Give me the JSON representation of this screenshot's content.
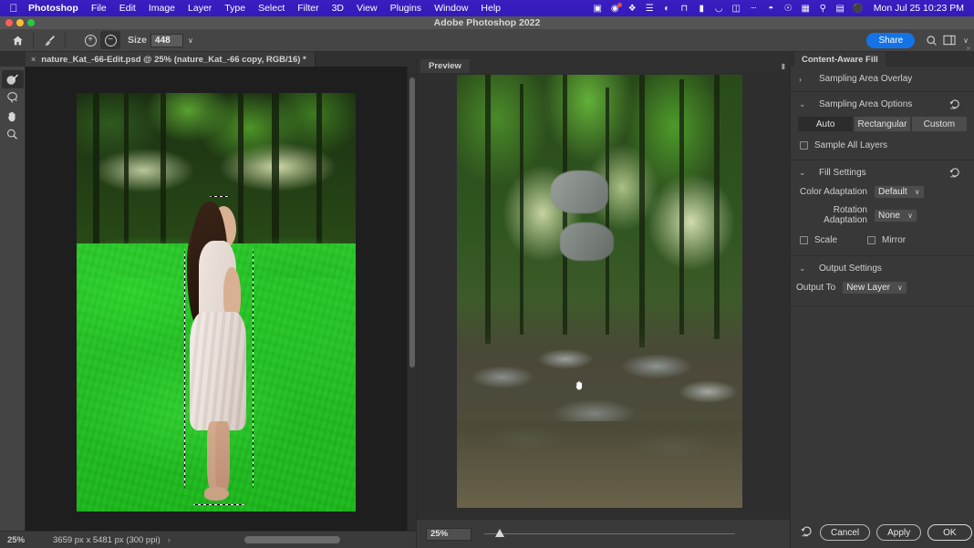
{
  "macos": {
    "apple_icon": "apple-icon",
    "menus": [
      "Photoshop",
      "File",
      "Edit",
      "Image",
      "Layer",
      "Type",
      "Select",
      "Filter",
      "3D",
      "View",
      "Plugins",
      "Window",
      "Help"
    ],
    "status_icons": [
      "screen-record-icon",
      "camera-icon",
      "dropbox-icon",
      "grid-icon",
      "time-machine-icon",
      "notion-icon",
      "bookmark-icon",
      "arc-icon",
      "columns-icon",
      "bluetooth-icon",
      "wifi-icon",
      "user-icon",
      "display-icon",
      "search-icon",
      "control-center-icon",
      "siri-icon"
    ],
    "clock": "Mon Jul 25  10:23 PM"
  },
  "titlebar": {
    "title": "Adobe Photoshop 2022",
    "close": "close-button",
    "minimize": "minimize-button",
    "maximize": "maximize-button"
  },
  "options_bar": {
    "home_icon": "home-icon",
    "tool_icon": "brush-tool-icon",
    "add_icon": "+",
    "subtract_icon": "−",
    "size_label": "Size",
    "size_value": "448",
    "size_caret": "∨",
    "share_label": "Share",
    "search_icon": "search-icon",
    "workspace_icon": "workspace-icon",
    "workspace_caret": "∨"
  },
  "document_tab": {
    "close_icon": "×",
    "title": "nature_Kat_-66-Edit.psd @ 25% (nature_Kat_-66 copy, RGB/16) *"
  },
  "toolbar": {
    "tools": [
      {
        "name": "sampling-brush-tool",
        "glyph": "὘",
        "active": true
      },
      {
        "name": "lasso-tool",
        "glyph": "␢",
        "active": false
      },
      {
        "name": "hand-tool",
        "glyph": "✋",
        "active": false
      },
      {
        "name": "zoom-tool",
        "glyph": "⚲",
        "active": false
      }
    ]
  },
  "canvas": {
    "alt": "Photo of a woman in a white dress standing in a green forest with a marching-ants selection around her and a green sampling-area overlay"
  },
  "statusbar": {
    "zoom": "25%",
    "dimensions": "3659 px x 5481 px (300 ppi)",
    "arrow": "›"
  },
  "preview": {
    "tab_label": "Preview",
    "alt": "Preview of the fill result: a forest stream with rocks and the woman removed",
    "cursor_icon": "hand-cursor-icon",
    "zoom_value": "25%",
    "grip_icon": "panel-grip-icon"
  },
  "content_aware_fill": {
    "tab_label": "Content-Aware Fill",
    "sections": [
      {
        "id": "sampling_area_overlay",
        "title": "Sampling Area Overlay",
        "twirl": "›",
        "expanded": false
      },
      {
        "id": "sampling_area_options",
        "title": "Sampling Area Options",
        "twirl": "⌄",
        "expanded": true,
        "reset_icon": "reset-icon",
        "segments": [
          {
            "label": "Auto",
            "active": true
          },
          {
            "label": "Rectangular",
            "active": false
          },
          {
            "label": "Custom",
            "active": false
          }
        ],
        "checkbox": {
          "label": "Sample All Layers",
          "checked": false
        }
      },
      {
        "id": "fill_settings",
        "title": "Fill Settings",
        "twirl": "⌄",
        "expanded": true,
        "reset_icon": "reset-icon",
        "fields": [
          {
            "label": "Color Adaptation",
            "value": "Default",
            "caret": "∨"
          },
          {
            "label": "Rotation Adaptation",
            "value": "None",
            "caret": "∨"
          }
        ],
        "checkboxes": [
          {
            "label": "Scale",
            "checked": false
          },
          {
            "label": "Mirror",
            "checked": false
          }
        ]
      },
      {
        "id": "output_settings",
        "title": "Output Settings",
        "twirl": "⌄",
        "expanded": true,
        "fields": [
          {
            "label": "Output To",
            "value": "New Layer",
            "caret": "∨"
          }
        ]
      }
    ],
    "footer": {
      "reset_icon": "reset-icon",
      "cancel_label": "Cancel",
      "apply_label": "Apply",
      "ok_label": "OK"
    }
  },
  "colors": {
    "menubar": "#3a1ec0",
    "accent_blue": "#1473e6",
    "panel_bg": "#383838",
    "canvas_bg": "#1e1e1e",
    "overlay_green": "#2cc62c"
  }
}
